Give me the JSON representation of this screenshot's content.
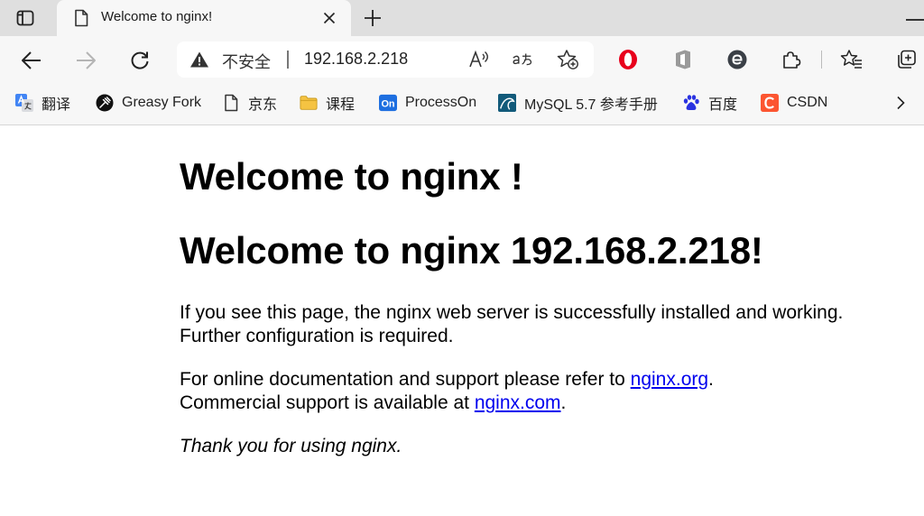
{
  "browser": {
    "tab": {
      "title": "Welcome to nginx!"
    },
    "address": {
      "security_label": "不安全",
      "url": "192.168.2.218"
    },
    "bookmarks": [
      {
        "label": "翻译",
        "icon": "google-translate-icon"
      },
      {
        "label": "Greasy Fork",
        "icon": "greasy-fork-icon"
      },
      {
        "label": "京东",
        "icon": "page-icon"
      },
      {
        "label": "课程",
        "icon": "folder-icon"
      },
      {
        "label": "ProcessOn",
        "icon": "processon-icon"
      },
      {
        "label": "MySQL 5.7 参考手册",
        "icon": "mysql-icon"
      },
      {
        "label": "百度",
        "icon": "baidu-paw-icon"
      },
      {
        "label": "CSDN",
        "icon": "csdn-icon"
      }
    ],
    "colors": {
      "tabstrip": "#dfdfdf",
      "toolbar": "#f7f7f7",
      "opera_red": "#e8001c",
      "csdn_orange": "#fc5531",
      "processon_blue": "#1e6fe0",
      "folder_yellow": "#f5c342",
      "link_blue": "#0000ee"
    }
  },
  "page": {
    "heading1": "Welcome to nginx !",
    "heading2": "Welcome to nginx 192.168.2.218!",
    "para1": "If you see this page, the nginx web server is successfully installed and working. Further configuration is required.",
    "para2_prefix": "For online documentation and support please refer to ",
    "para2_link1": "nginx.org",
    "para2_middle": ".",
    "para2_prefix2": "Commercial support is available at ",
    "para2_link2": "nginx.com",
    "para2_end": ".",
    "para3": "Thank you for using nginx."
  }
}
